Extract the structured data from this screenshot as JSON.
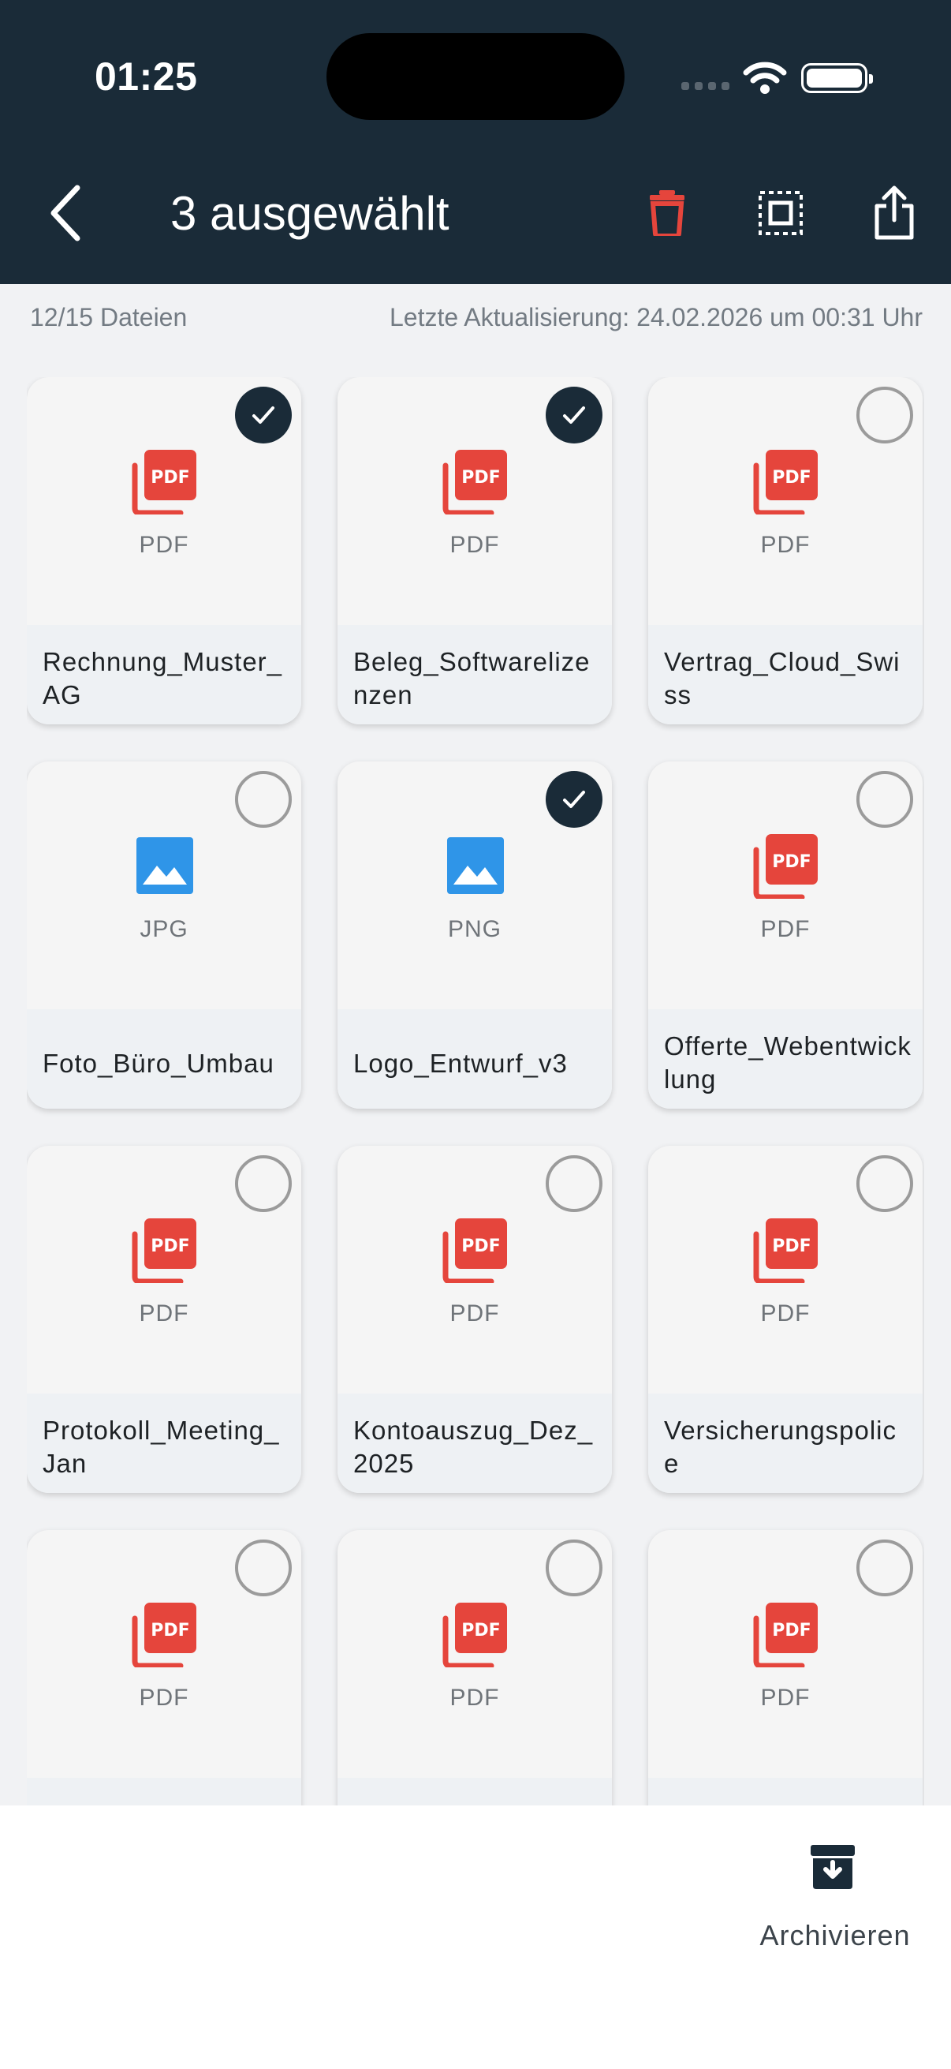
{
  "status_bar": {
    "time": "01:25"
  },
  "header": {
    "title": "3 ausgewählt"
  },
  "meta": {
    "count": "12/15 Dateien",
    "updated": "Letzte Aktualisierung: 24.02.2026 um 00:31 Uhr"
  },
  "colors": {
    "header_bg": "#1a2b38",
    "pdf_red": "#e5453c",
    "image_blue": "#2f95e8",
    "delete_red": "#e5453c"
  },
  "files": [
    {
      "name": "Rechnung_Muster_AG",
      "type": "PDF",
      "icon": "pdf-icon",
      "selected": true
    },
    {
      "name": "Beleg_Softwarelizenzen",
      "type": "PDF",
      "icon": "pdf-icon",
      "selected": true
    },
    {
      "name": "Vertrag_Cloud_Swiss",
      "type": "PDF",
      "icon": "pdf-icon",
      "selected": false
    },
    {
      "name": "Foto_Büro_Umbau",
      "type": "JPG",
      "icon": "image-icon",
      "selected": false
    },
    {
      "name": "Logo_Entwurf_v3",
      "type": "PNG",
      "icon": "image-icon",
      "selected": true
    },
    {
      "name": "Offerte_Webentwicklung",
      "type": "PDF",
      "icon": "pdf-icon",
      "selected": false
    },
    {
      "name": "Protokoll_Meeting_Jan",
      "type": "PDF",
      "icon": "pdf-icon",
      "selected": false
    },
    {
      "name": "Kontoauszug_Dez_2025",
      "type": "PDF",
      "icon": "pdf-icon",
      "selected": false
    },
    {
      "name": "Versicherungspolice",
      "type": "PDF",
      "icon": "pdf-icon",
      "selected": false
    },
    {
      "name": "",
      "type": "PDF",
      "icon": "pdf-icon",
      "selected": false
    },
    {
      "name": "",
      "type": "PDF",
      "icon": "pdf-icon",
      "selected": false
    },
    {
      "name": "",
      "type": "PDF",
      "icon": "pdf-icon",
      "selected": false
    }
  ],
  "bottom_bar": {
    "archive_label": "Archivieren"
  }
}
